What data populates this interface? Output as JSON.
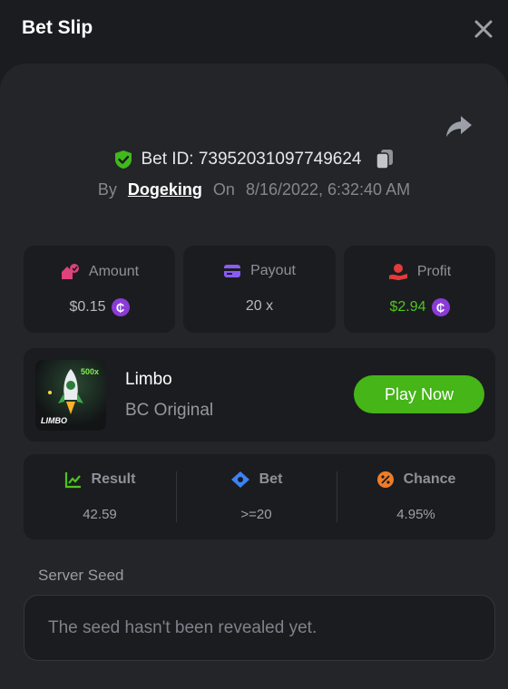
{
  "header": {
    "title": "Bet Slip"
  },
  "bet": {
    "id_text": "Bet ID: 73952031097749624",
    "by_label": "By",
    "user": "Dogeking",
    "on_label": "On",
    "datetime": "8/16/2022, 6:32:40 AM"
  },
  "stats": {
    "amount": {
      "label": "Amount",
      "value": "$0.15"
    },
    "payout": {
      "label": "Payout",
      "value": "20 x"
    },
    "profit": {
      "label": "Profit",
      "value": "$2.94"
    }
  },
  "game": {
    "name": "Limbo",
    "subtitle": "BC Original",
    "play_label": "Play Now",
    "thumb_label": "LIMBO",
    "thumb_multiplier": "500x"
  },
  "result": {
    "result": {
      "label": "Result",
      "value": "42.59"
    },
    "bet": {
      "label": "Bet",
      "value": ">=20"
    },
    "chance": {
      "label": "Chance",
      "value": "4.95%"
    }
  },
  "seed": {
    "label": "Server Seed",
    "text": "The seed hasn't been revealed yet."
  },
  "colors": {
    "accent_green": "#45b518",
    "profit_green": "#4ec51f",
    "coin_purple": "#8a3bd8",
    "amount_icon": "#e0427a",
    "payout_icon": "#8a5cf5",
    "profit_icon": "#e23b3b",
    "result_icon": "#4ec51f",
    "bet_icon": "#3b82f6",
    "chance_icon": "#f07c28"
  },
  "icons": {
    "close": "close-icon",
    "share": "share-arrow-icon",
    "shield": "shield-check-icon",
    "copy": "copy-icon",
    "coin": "coin-icon"
  }
}
